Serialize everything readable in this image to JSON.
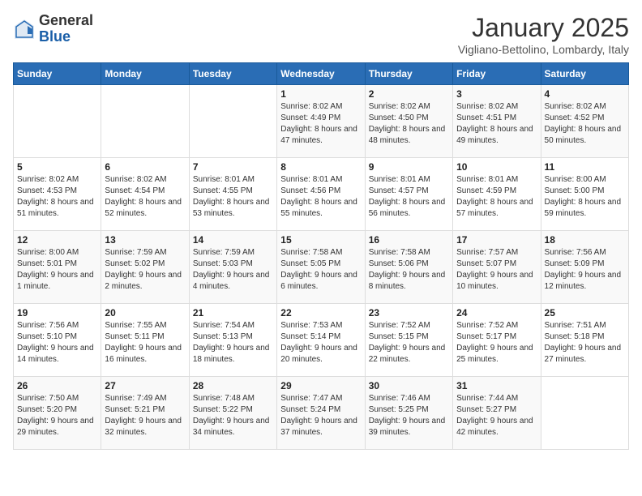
{
  "header": {
    "logo_general": "General",
    "logo_blue": "Blue",
    "month_year": "January 2025",
    "location": "Vigliano-Bettolino, Lombardy, Italy"
  },
  "days_of_week": [
    "Sunday",
    "Monday",
    "Tuesday",
    "Wednesday",
    "Thursday",
    "Friday",
    "Saturday"
  ],
  "weeks": [
    [
      {
        "day": "",
        "info": ""
      },
      {
        "day": "",
        "info": ""
      },
      {
        "day": "",
        "info": ""
      },
      {
        "day": "1",
        "info": "Sunrise: 8:02 AM\nSunset: 4:49 PM\nDaylight: 8 hours and 47 minutes."
      },
      {
        "day": "2",
        "info": "Sunrise: 8:02 AM\nSunset: 4:50 PM\nDaylight: 8 hours and 48 minutes."
      },
      {
        "day": "3",
        "info": "Sunrise: 8:02 AM\nSunset: 4:51 PM\nDaylight: 8 hours and 49 minutes."
      },
      {
        "day": "4",
        "info": "Sunrise: 8:02 AM\nSunset: 4:52 PM\nDaylight: 8 hours and 50 minutes."
      }
    ],
    [
      {
        "day": "5",
        "info": "Sunrise: 8:02 AM\nSunset: 4:53 PM\nDaylight: 8 hours and 51 minutes."
      },
      {
        "day": "6",
        "info": "Sunrise: 8:02 AM\nSunset: 4:54 PM\nDaylight: 8 hours and 52 minutes."
      },
      {
        "day": "7",
        "info": "Sunrise: 8:01 AM\nSunset: 4:55 PM\nDaylight: 8 hours and 53 minutes."
      },
      {
        "day": "8",
        "info": "Sunrise: 8:01 AM\nSunset: 4:56 PM\nDaylight: 8 hours and 55 minutes."
      },
      {
        "day": "9",
        "info": "Sunrise: 8:01 AM\nSunset: 4:57 PM\nDaylight: 8 hours and 56 minutes."
      },
      {
        "day": "10",
        "info": "Sunrise: 8:01 AM\nSunset: 4:59 PM\nDaylight: 8 hours and 57 minutes."
      },
      {
        "day": "11",
        "info": "Sunrise: 8:00 AM\nSunset: 5:00 PM\nDaylight: 8 hours and 59 minutes."
      }
    ],
    [
      {
        "day": "12",
        "info": "Sunrise: 8:00 AM\nSunset: 5:01 PM\nDaylight: 9 hours and 1 minute."
      },
      {
        "day": "13",
        "info": "Sunrise: 7:59 AM\nSunset: 5:02 PM\nDaylight: 9 hours and 2 minutes."
      },
      {
        "day": "14",
        "info": "Sunrise: 7:59 AM\nSunset: 5:03 PM\nDaylight: 9 hours and 4 minutes."
      },
      {
        "day": "15",
        "info": "Sunrise: 7:58 AM\nSunset: 5:05 PM\nDaylight: 9 hours and 6 minutes."
      },
      {
        "day": "16",
        "info": "Sunrise: 7:58 AM\nSunset: 5:06 PM\nDaylight: 9 hours and 8 minutes."
      },
      {
        "day": "17",
        "info": "Sunrise: 7:57 AM\nSunset: 5:07 PM\nDaylight: 9 hours and 10 minutes."
      },
      {
        "day": "18",
        "info": "Sunrise: 7:56 AM\nSunset: 5:09 PM\nDaylight: 9 hours and 12 minutes."
      }
    ],
    [
      {
        "day": "19",
        "info": "Sunrise: 7:56 AM\nSunset: 5:10 PM\nDaylight: 9 hours and 14 minutes."
      },
      {
        "day": "20",
        "info": "Sunrise: 7:55 AM\nSunset: 5:11 PM\nDaylight: 9 hours and 16 minutes."
      },
      {
        "day": "21",
        "info": "Sunrise: 7:54 AM\nSunset: 5:13 PM\nDaylight: 9 hours and 18 minutes."
      },
      {
        "day": "22",
        "info": "Sunrise: 7:53 AM\nSunset: 5:14 PM\nDaylight: 9 hours and 20 minutes."
      },
      {
        "day": "23",
        "info": "Sunrise: 7:52 AM\nSunset: 5:15 PM\nDaylight: 9 hours and 22 minutes."
      },
      {
        "day": "24",
        "info": "Sunrise: 7:52 AM\nSunset: 5:17 PM\nDaylight: 9 hours and 25 minutes."
      },
      {
        "day": "25",
        "info": "Sunrise: 7:51 AM\nSunset: 5:18 PM\nDaylight: 9 hours and 27 minutes."
      }
    ],
    [
      {
        "day": "26",
        "info": "Sunrise: 7:50 AM\nSunset: 5:20 PM\nDaylight: 9 hours and 29 minutes."
      },
      {
        "day": "27",
        "info": "Sunrise: 7:49 AM\nSunset: 5:21 PM\nDaylight: 9 hours and 32 minutes."
      },
      {
        "day": "28",
        "info": "Sunrise: 7:48 AM\nSunset: 5:22 PM\nDaylight: 9 hours and 34 minutes."
      },
      {
        "day": "29",
        "info": "Sunrise: 7:47 AM\nSunset: 5:24 PM\nDaylight: 9 hours and 37 minutes."
      },
      {
        "day": "30",
        "info": "Sunrise: 7:46 AM\nSunset: 5:25 PM\nDaylight: 9 hours and 39 minutes."
      },
      {
        "day": "31",
        "info": "Sunrise: 7:44 AM\nSunset: 5:27 PM\nDaylight: 9 hours and 42 minutes."
      },
      {
        "day": "",
        "info": ""
      }
    ]
  ]
}
